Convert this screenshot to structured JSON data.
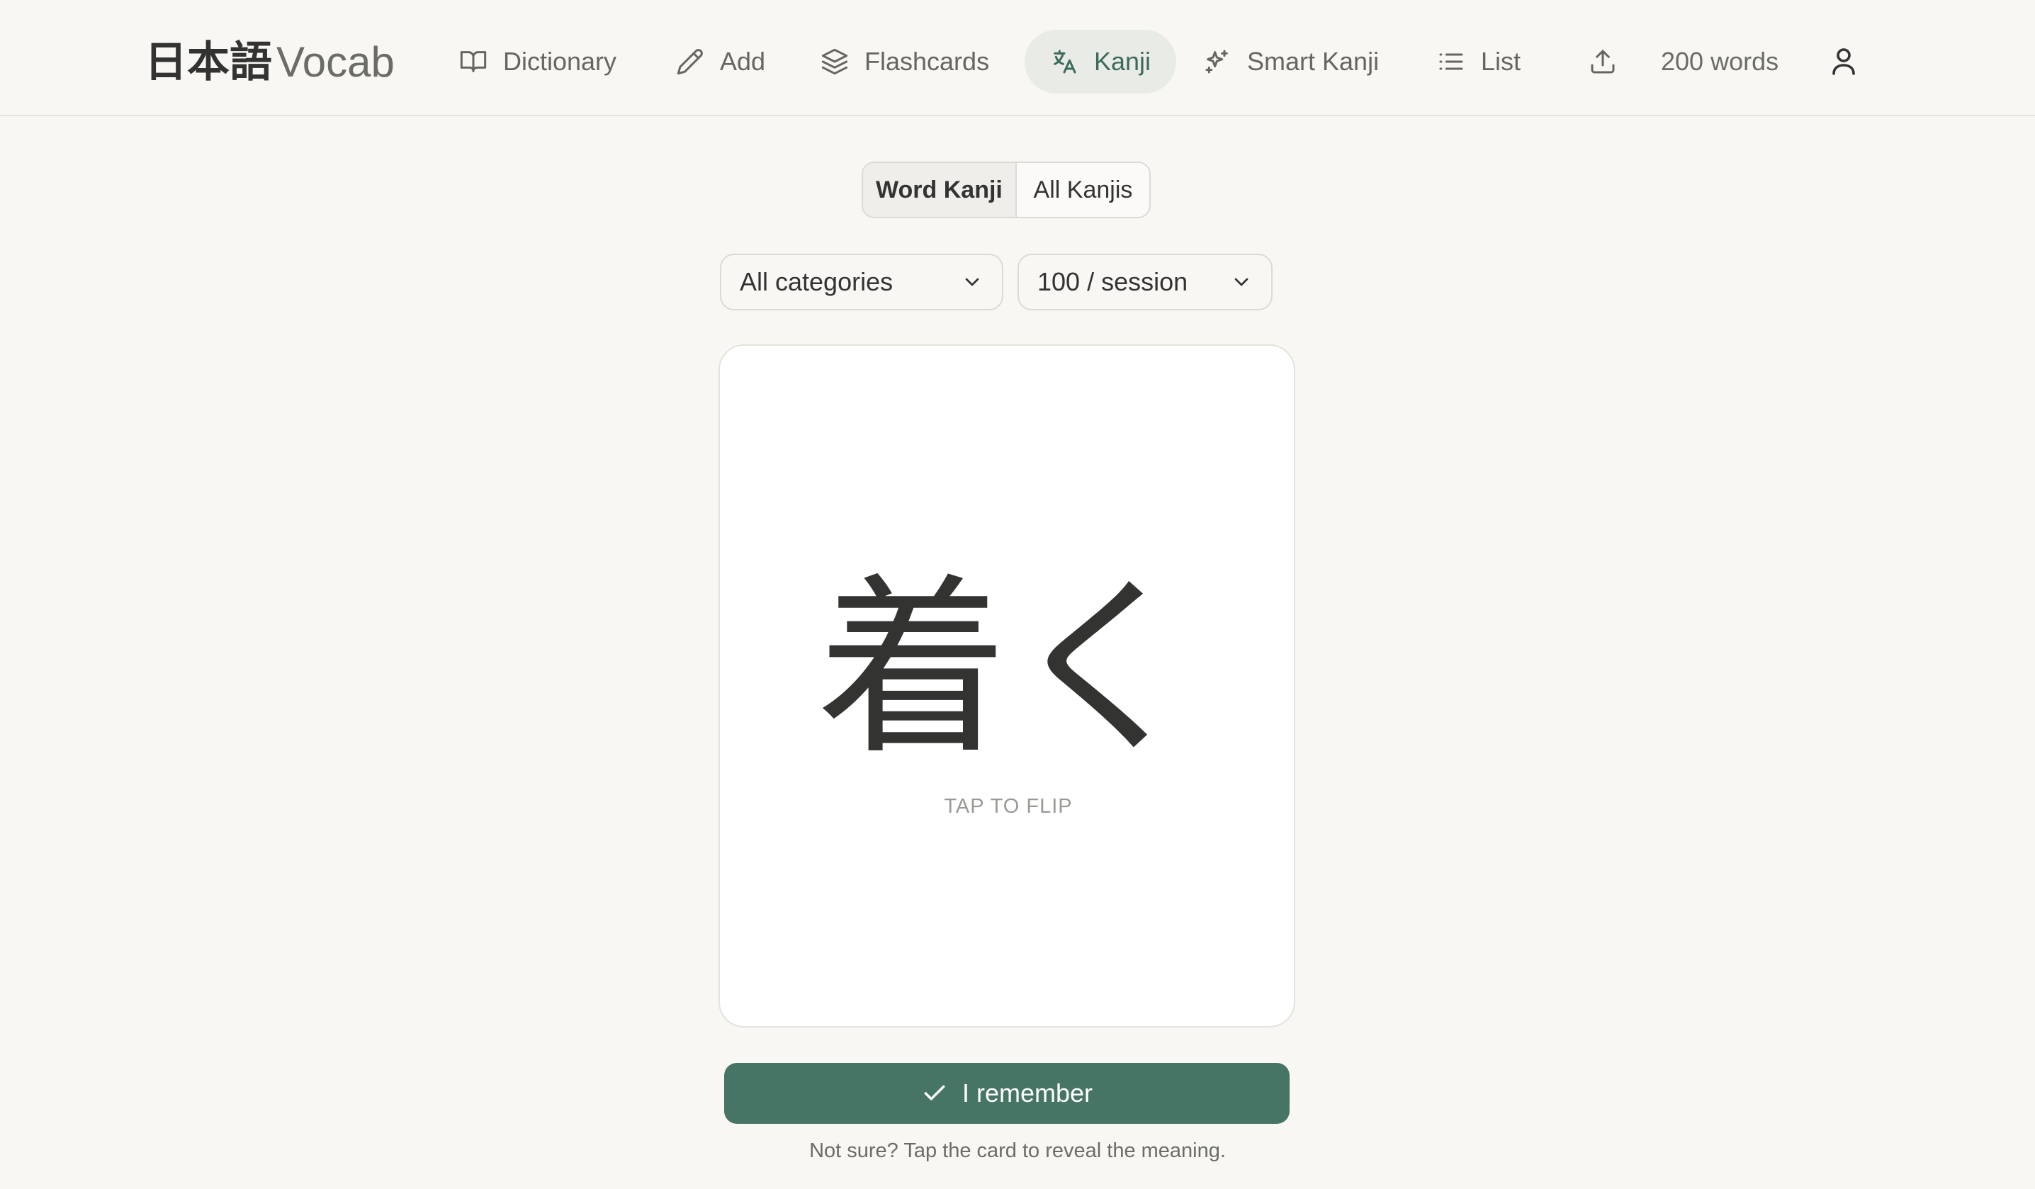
{
  "brand": {
    "japanese": "日本語",
    "name": "Vocab"
  },
  "nav": [
    {
      "label": "Dictionary",
      "icon": "book-icon"
    },
    {
      "label": "Add",
      "icon": "pencil-icon"
    },
    {
      "label": "Flashcards",
      "icon": "layers-icon"
    },
    {
      "label": "Kanji",
      "icon": "translate-icon",
      "active": true
    },
    {
      "label": "Smart Kanji",
      "icon": "sparkles-icon"
    },
    {
      "label": "List",
      "icon": "list-icon"
    }
  ],
  "upload_icon": "upload-icon",
  "word_count": "200 words",
  "user_icon": "user-icon",
  "mode_toggle": {
    "selected": "Word Kanji",
    "options": [
      "Word Kanji",
      "All Kanjis"
    ]
  },
  "filters": {
    "category": "All categories",
    "session": "100 / session"
  },
  "card": {
    "kanji": "着く",
    "hint": "TAP TO FLIP"
  },
  "remember_button": "I remember",
  "footnote": "Not sure? Tap the card to reveal the meaning.",
  "colors": {
    "accent": "#467565",
    "active_nav_text": "#3d6b5a",
    "background": "#f8f7f4"
  }
}
